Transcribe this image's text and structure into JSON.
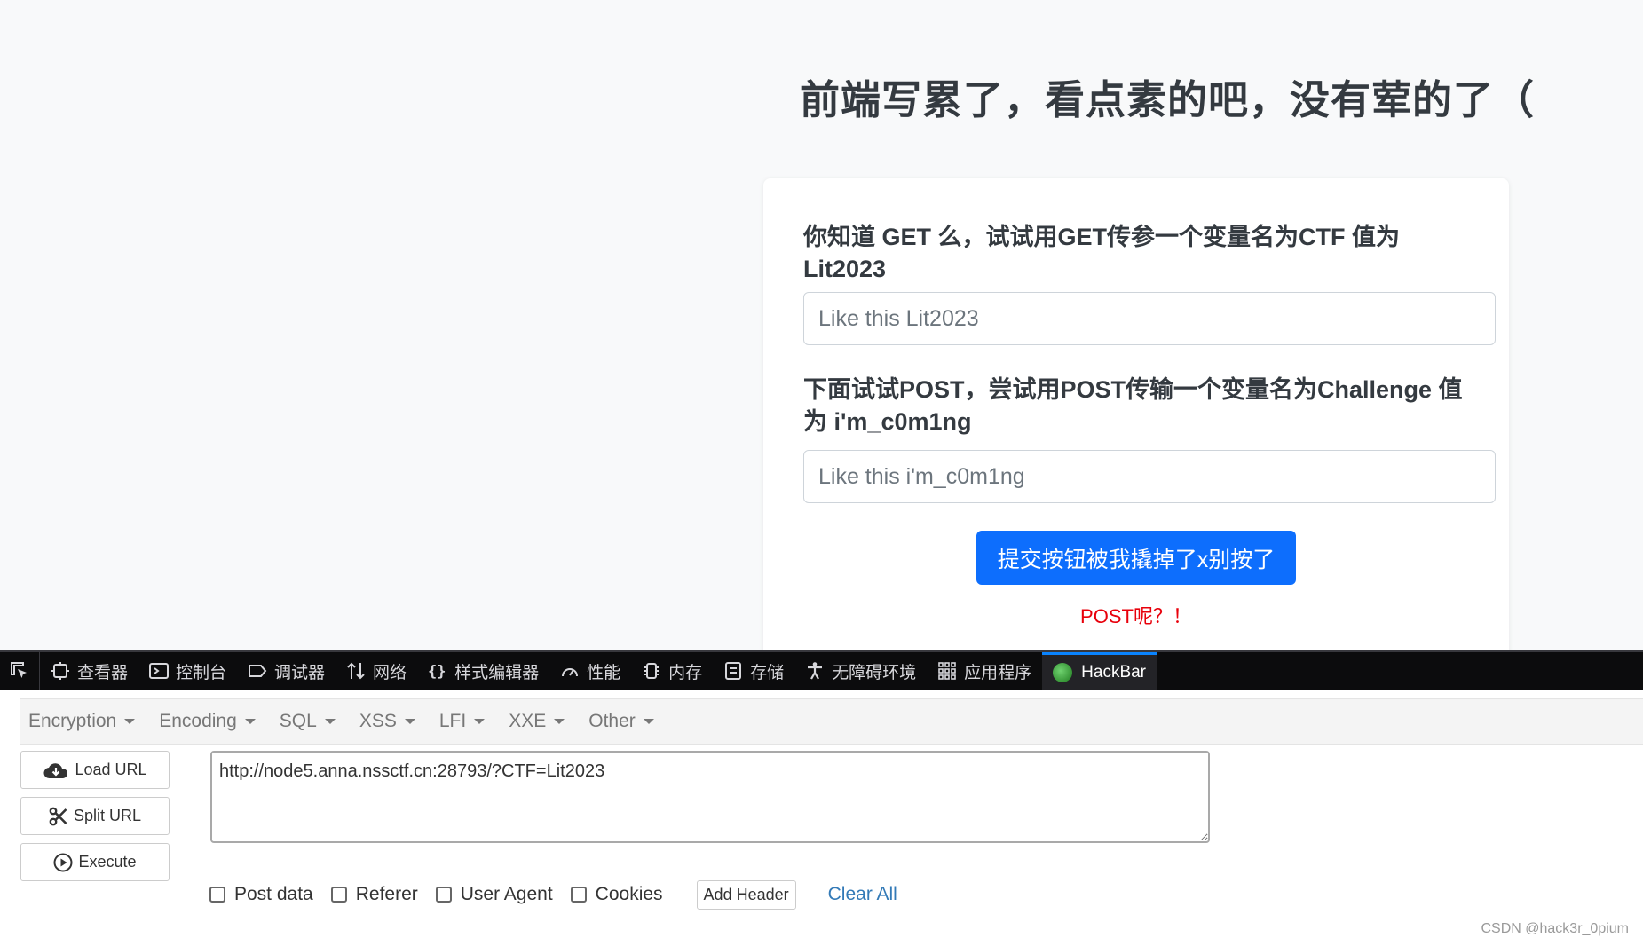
{
  "page": {
    "headline": "前端写累了，看点素的吧，没有荤的了（",
    "question1": "你知道 GET 么，试试用GET传参一个变量名为CTF 值为 Lit2023",
    "input1_placeholder": "Like this Lit2023",
    "question2": "下面试试POST，尝试用POST传输一个变量名为Challenge 值为 i'm_c0m1ng",
    "input2_placeholder": "Like this i'm_c0m1ng",
    "submit_label": "提交按钮被我撬掉了x别按了",
    "hint": "POST呢？！"
  },
  "devtools": {
    "tabs": [
      {
        "label": "查看器",
        "icon": "inspector-icon"
      },
      {
        "label": "控制台",
        "icon": "console-icon"
      },
      {
        "label": "调试器",
        "icon": "debugger-icon"
      },
      {
        "label": "网络",
        "icon": "network-icon"
      },
      {
        "label": "样式编辑器",
        "icon": "style-editor-icon"
      },
      {
        "label": "性能",
        "icon": "performance-icon"
      },
      {
        "label": "内存",
        "icon": "memory-icon"
      },
      {
        "label": "存储",
        "icon": "storage-icon"
      },
      {
        "label": "无障碍环境",
        "icon": "accessibility-icon"
      },
      {
        "label": "应用程序",
        "icon": "application-icon"
      },
      {
        "label": "HackBar",
        "icon": "hackbar-logo-icon"
      }
    ],
    "active_tab": "HackBar",
    "accent_color": "#0a84ff"
  },
  "hackbar": {
    "menu": [
      "Encryption",
      "Encoding",
      "SQL",
      "XSS",
      "LFI",
      "XXE",
      "Other"
    ],
    "load_url": "Load URL",
    "split_url": "Split URL",
    "execute": "Execute",
    "url": "http://node5.anna.nssctf.cn:28793/?CTF=Lit2023",
    "options": [
      "Post data",
      "Referer",
      "User Agent",
      "Cookies"
    ],
    "add_header": "Add Header",
    "clear_all": "Clear All"
  },
  "watermark": "CSDN @hack3r_0pium",
  "colors": {
    "primary_button": "#0d6efd",
    "hint_red": "#e8000b",
    "link_blue": "#337ab7"
  }
}
